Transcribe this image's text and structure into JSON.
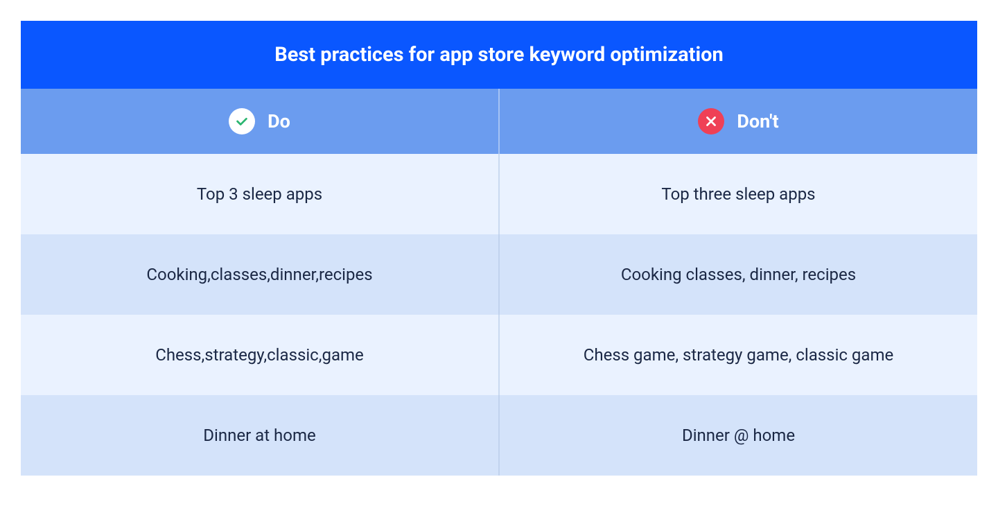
{
  "title": "Best practices for app store keyword optimization",
  "columns": {
    "do": "Do",
    "dont": "Don't"
  },
  "rows": [
    {
      "do": "Top 3 sleep apps",
      "dont": "Top three sleep apps"
    },
    {
      "do": "Cooking,classes,dinner,recipes",
      "dont": "Cooking classes, dinner, recipes"
    },
    {
      "do": "Chess,strategy,classic,game",
      "dont": "Chess game, strategy game, classic game"
    },
    {
      "do": "Dinner at home",
      "dont": "Dinner @ home"
    }
  ],
  "colors": {
    "titleBg": "#0a57ff",
    "headerBg": "#6b9cef",
    "rowLight": "#eaf2ff",
    "rowDark": "#d4e3fa",
    "checkCircle": "#ffffff",
    "checkStroke": "#2ab56f",
    "crossCircle": "#ef4056",
    "crossStroke": "#ffffff",
    "text": "#1a2744"
  }
}
